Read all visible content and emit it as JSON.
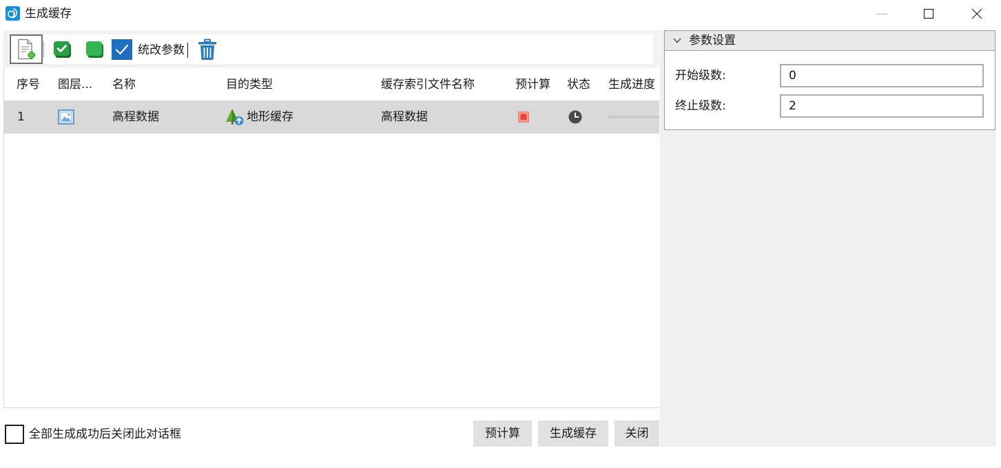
{
  "window": {
    "title": "生成缓存",
    "app_icon": "app-logo-icon",
    "controls": [
      "minimize-icon",
      "maximize-icon",
      "close-icon"
    ]
  },
  "toolbar": {
    "new_task": {
      "icon": "new-task-icon"
    },
    "select_all": {
      "icon": "check-all-icon"
    },
    "deselect_all": {
      "icon": "uncheck-all-icon"
    },
    "batch_edit": {
      "label": "统改参数",
      "checked": true
    },
    "delete": {
      "icon": "delete-icon"
    }
  },
  "table": {
    "columns": [
      "序号",
      "图层...",
      "名称",
      "目的类型",
      "缓存索引文件名称",
      "预计算",
      "状态",
      "生成进度"
    ],
    "rows": [
      {
        "index": "1",
        "layer_icon": "raster-layer-icon",
        "name": "高程数据",
        "target_type_icon": "terrain-cache-icon",
        "target_type": "地形缓存",
        "index_file_name": "高程数据",
        "precompute_icon": "stop-icon",
        "status_icon": "clock-icon",
        "progress": 0,
        "selected": true
      }
    ]
  },
  "footer": {
    "close_on_success": {
      "label": "全部生成成功后关闭此对话框",
      "checked": false
    },
    "buttons": {
      "precompute": "预计算",
      "generate": "生成缓存",
      "close": "关闭"
    }
  },
  "params": {
    "title": "参数设置",
    "header_icon": "chevron-down-icon",
    "start_level": {
      "label": "开始级数:",
      "value": "0"
    },
    "end_level": {
      "label": "终止级数:",
      "value": "2"
    }
  },
  "colors": {
    "accent_blue": "#1e6fc0",
    "selected_row": "#d9d9d9",
    "panel_bg": "#f0f0f0",
    "button_bg": "#e1e1e1",
    "stop_red": "#e8483b",
    "icon_green": "#2e9e44"
  }
}
